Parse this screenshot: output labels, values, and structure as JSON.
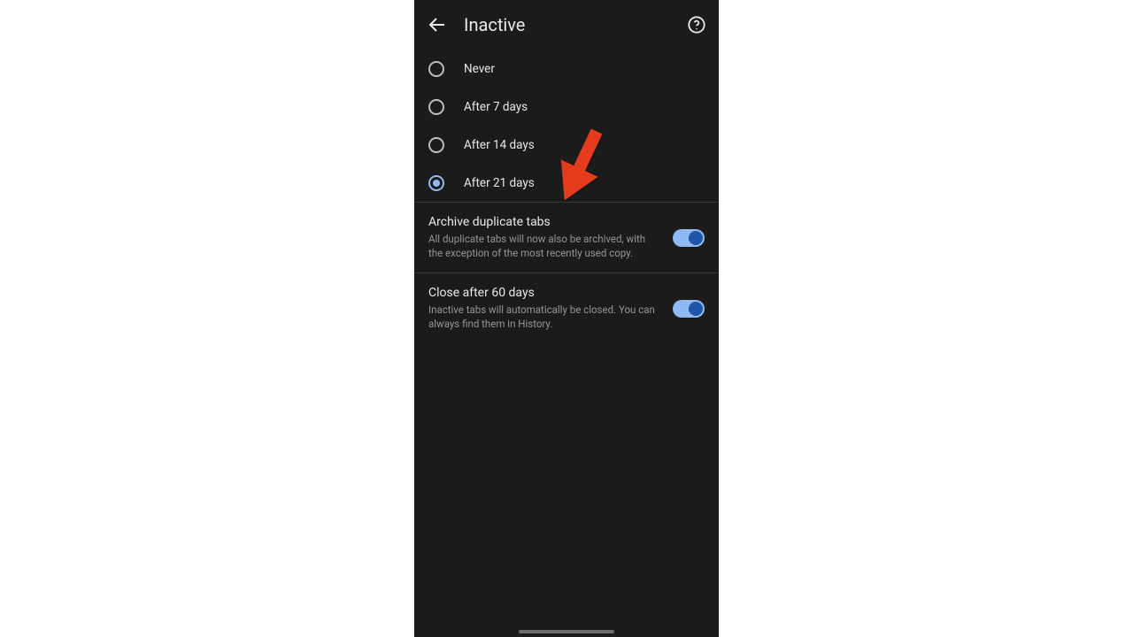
{
  "header": {
    "title": "Inactive"
  },
  "radio": {
    "options": [
      {
        "label": "Never",
        "selected": false
      },
      {
        "label": "After 7 days",
        "selected": false
      },
      {
        "label": "After 14 days",
        "selected": false
      },
      {
        "label": "After 21 days",
        "selected": true
      }
    ]
  },
  "toggles": [
    {
      "title": "Archive duplicate tabs",
      "desc": "All duplicate tabs will now also be archived, with the exception of the most recently used copy.",
      "on": true
    },
    {
      "title": "Close after 60 days",
      "desc": "Inactive tabs will automatically be closed. You can always find them in History.",
      "on": true
    }
  ]
}
